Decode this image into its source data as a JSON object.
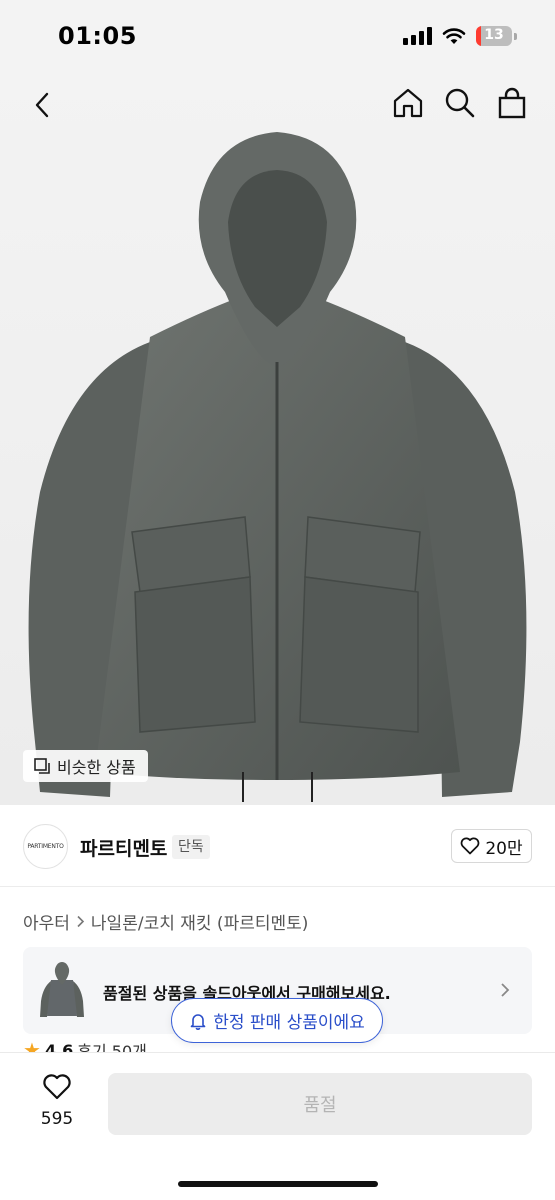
{
  "status_bar": {
    "time": "01:05",
    "battery_level": "13",
    "battery_color": "#ff3b30"
  },
  "nav": {
    "back_icon": "chevron-left-icon",
    "icons": [
      "home-icon",
      "search-icon",
      "shopping-bag-icon"
    ]
  },
  "hero": {
    "similar_button_label": "비슷한 상품"
  },
  "brand": {
    "logo_text": "PARTIMENTO",
    "name": "파르티멘토",
    "tag": "단독",
    "like_count": "20만"
  },
  "breadcrumb": {
    "category": "아우터",
    "subcategory": "나일론/코치 재킷 (파르티멘토)"
  },
  "soldout_banner": {
    "text": "품절된 상품을 솔드아웃에서 구매해보세요."
  },
  "limited_badge": {
    "label": "한정 판매 상품이에요"
  },
  "rating": {
    "score": "4.6",
    "reviews": "후기 50개"
  },
  "bottom_bar": {
    "wish_count": "595",
    "buy_label": "품절"
  },
  "colors": {
    "accent_blue": "#3d63d8",
    "disabled_button": "#ececec",
    "rating_star": "#f5a623"
  }
}
